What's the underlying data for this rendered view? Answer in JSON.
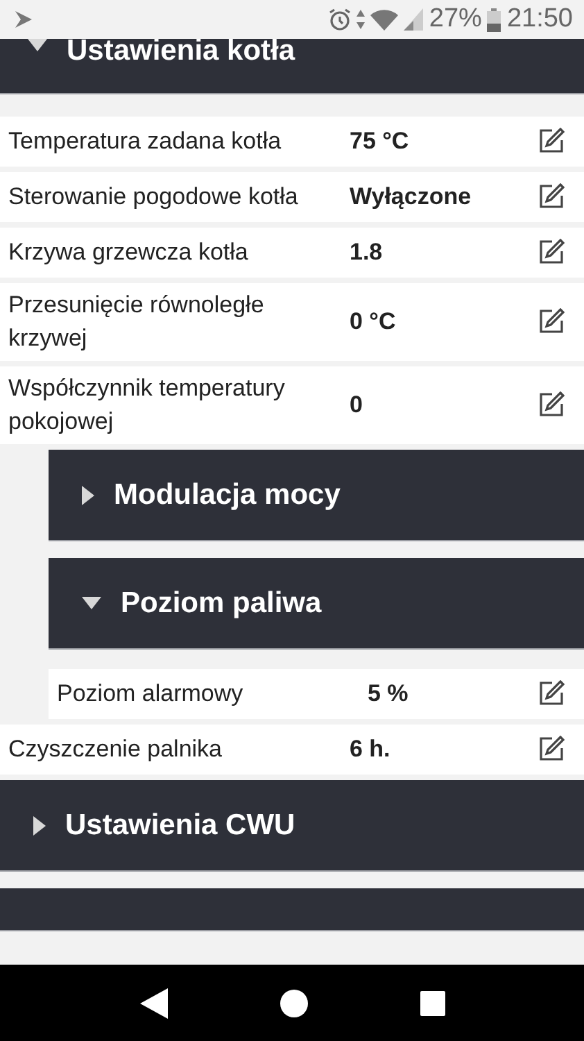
{
  "status_bar": {
    "battery": "27%",
    "time": "21:50"
  },
  "panels": [
    {
      "title": "Ustawienia kotła",
      "expanded": true,
      "items": [
        {
          "kind": "setting",
          "label": "Temperatura zadana kotła",
          "value": "75 °C"
        },
        {
          "kind": "setting",
          "label": "Sterowanie pogodowe kotła",
          "value": "Wyłączone"
        },
        {
          "kind": "setting",
          "label": "Krzywa grzewcza kotła",
          "value": "1.8"
        },
        {
          "kind": "setting",
          "label": "Przesunięcie równoległe krzywej",
          "value": "0 °C"
        },
        {
          "kind": "setting",
          "label": "Współczynnik temperatury pokojowej",
          "value": "0"
        },
        {
          "kind": "group",
          "title": "Modulacja mocy",
          "expanded": false
        },
        {
          "kind": "group",
          "title": "Poziom paliwa",
          "expanded": true,
          "items": [
            {
              "kind": "setting",
              "label": "Poziom alarmowy",
              "value": "5 %"
            }
          ]
        },
        {
          "kind": "setting",
          "label": "Czyszczenie palnika",
          "value": "6 h."
        }
      ]
    },
    {
      "title": "Ustawienia CWU",
      "expanded": false
    }
  ]
}
